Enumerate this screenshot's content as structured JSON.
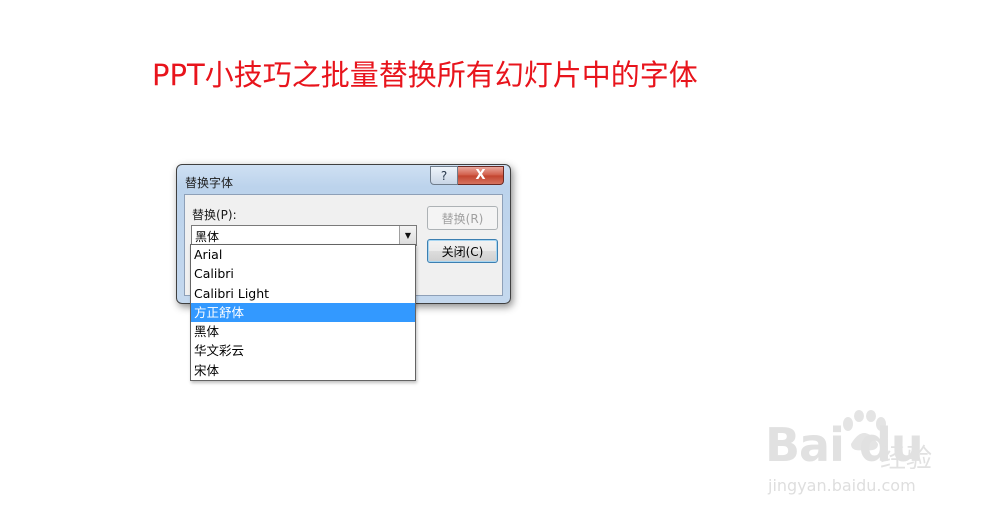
{
  "page": {
    "title": "PPT小技巧之批量替换所有幻灯片中的字体"
  },
  "dialog": {
    "title": "替换字体",
    "help_label": "?",
    "close_label": "X",
    "replace_field_label": "替换(P):",
    "replace_value": "黑体",
    "replace_button_label": "替换(R)",
    "close_button_label": "关闭(C)"
  },
  "dropdown": {
    "items": [
      {
        "label": "Arial",
        "selected": false
      },
      {
        "label": "Calibri",
        "selected": false
      },
      {
        "label": "Calibri Light",
        "selected": false
      },
      {
        "label": "方正舒体",
        "selected": true
      },
      {
        "label": "黑体",
        "selected": false
      },
      {
        "label": "华文彩云",
        "selected": false
      },
      {
        "label": "宋体",
        "selected": false
      }
    ]
  },
  "watermark": {
    "logo_text": "Bai du",
    "jingyan_text": "经验",
    "url": "jingyan.baidu.com"
  },
  "colors": {
    "title_red": "#e8141c",
    "selection_blue": "#3399ff"
  }
}
